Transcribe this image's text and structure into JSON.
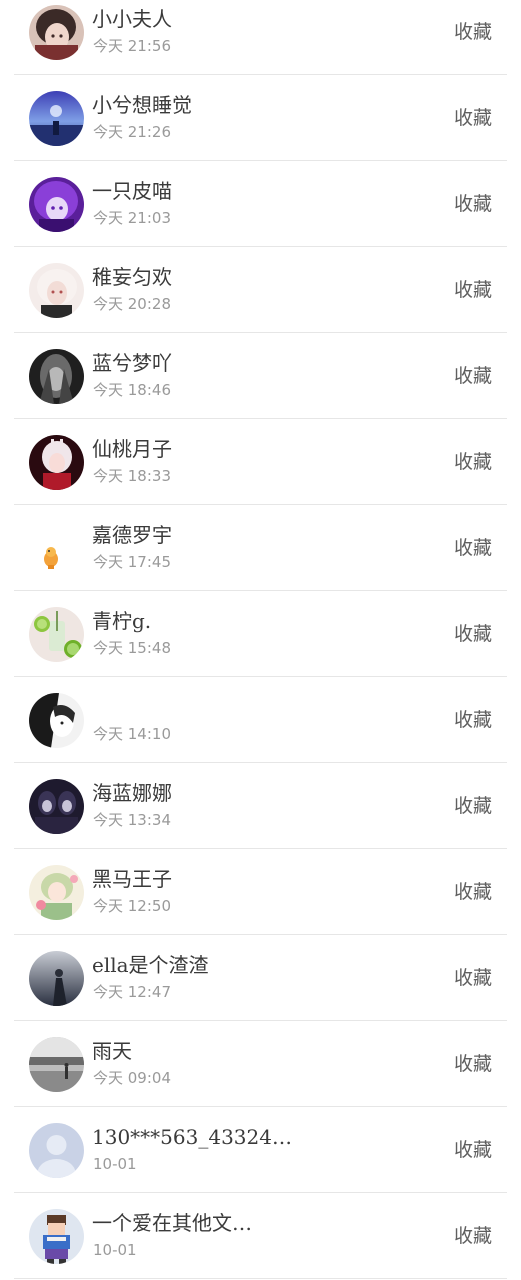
{
  "collect_label": "收藏",
  "items": [
    {
      "name": "小小夫人",
      "time": "今天 21:56",
      "avatar": "avatar-girl-dark-hair"
    },
    {
      "name": "小兮想睡觉",
      "time": "今天 21:26",
      "avatar": "avatar-night-sky"
    },
    {
      "name": "一只皮喵",
      "time": "今天 21:03",
      "avatar": "avatar-purple-anime"
    },
    {
      "name": "稚妄匀欢",
      "time": "今天 20:28",
      "avatar": "avatar-pale-anime"
    },
    {
      "name": "蓝兮梦吖",
      "time": "今天 18:46",
      "avatar": "avatar-dark-sketch"
    },
    {
      "name": "仙桃月子",
      "time": "今天 18:33",
      "avatar": "avatar-red-anime"
    },
    {
      "name": "嘉德罗宇",
      "time": "今天 17:45",
      "avatar": "avatar-orange-cartoon"
    },
    {
      "name": "青柠g.",
      "time": "今天 15:48",
      "avatar": "avatar-lime-drink"
    },
    {
      "name": "",
      "time": "今天 14:10",
      "avatar": "avatar-bw-anime"
    },
    {
      "name": "海蓝娜娜",
      "time": "今天 13:34",
      "avatar": "avatar-dark-couple"
    },
    {
      "name": "黑马王子",
      "time": "今天 12:50",
      "avatar": "avatar-pastel-anime"
    },
    {
      "name": "ella是个渣渣",
      "time": "今天 12:47",
      "avatar": "avatar-misty-figure"
    },
    {
      "name": "雨天",
      "time": "今天 09:04",
      "avatar": "avatar-rainy-street"
    },
    {
      "name": "130***563_43324…",
      "time": "10-01",
      "avatar": "avatar-default-silhouette"
    },
    {
      "name": "一个爱在其他文…",
      "time": "10-01",
      "avatar": "avatar-pixel-character"
    }
  ]
}
